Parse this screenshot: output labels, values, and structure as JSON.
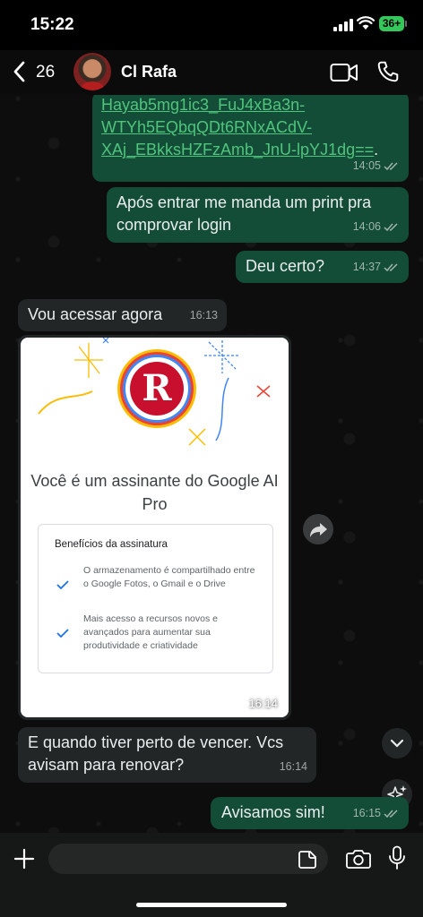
{
  "status_bar": {
    "time": "15:22",
    "battery": "36+"
  },
  "header": {
    "back_count": "26",
    "contact_name": "Cl Rafa"
  },
  "messages": [
    {
      "type": "out",
      "link_lines": [
        "Hayab5mg1ic3_FuJ4xBa3n-",
        "WTYh5EQbqQDt6RNxACdV-",
        "XAj_EBkksHZFzAmb_JnU-lpYJ1dg=="
      ],
      "trail": ".",
      "time": "14:05"
    },
    {
      "type": "out",
      "text": "Após entrar me manda um print pra comprovar login",
      "time": "14:06"
    },
    {
      "type": "out",
      "text": "Deu certo?",
      "time": "14:37"
    },
    {
      "type": "in",
      "text": "Vou acessar agora",
      "time": "16:13"
    },
    {
      "type": "in-image",
      "time": "16:14",
      "image": {
        "subscriber_text": "Você é um assinante do Google AI Pro",
        "benefits_title": "Benefícios da assinatura",
        "benefits": [
          "O armazenamento é compartilhado entre o Google Fotos, o Gmail e o Drive",
          "Mais acesso a recursos novos e avançados para aumentar sua produtividade e criatividade"
        ],
        "logo_letter": "R"
      }
    },
    {
      "type": "in",
      "text": "E quando tiver perto de vencer. Vcs avisam para renovar?",
      "time": "16:14"
    },
    {
      "type": "out",
      "text": "Avisamos sim!",
      "time": "16:15"
    }
  ],
  "composer": {
    "placeholder": ""
  },
  "colors": {
    "outgoing": "#144d37",
    "incoming": "#232626",
    "link": "#4fc47c",
    "check": "#1a73e8"
  }
}
